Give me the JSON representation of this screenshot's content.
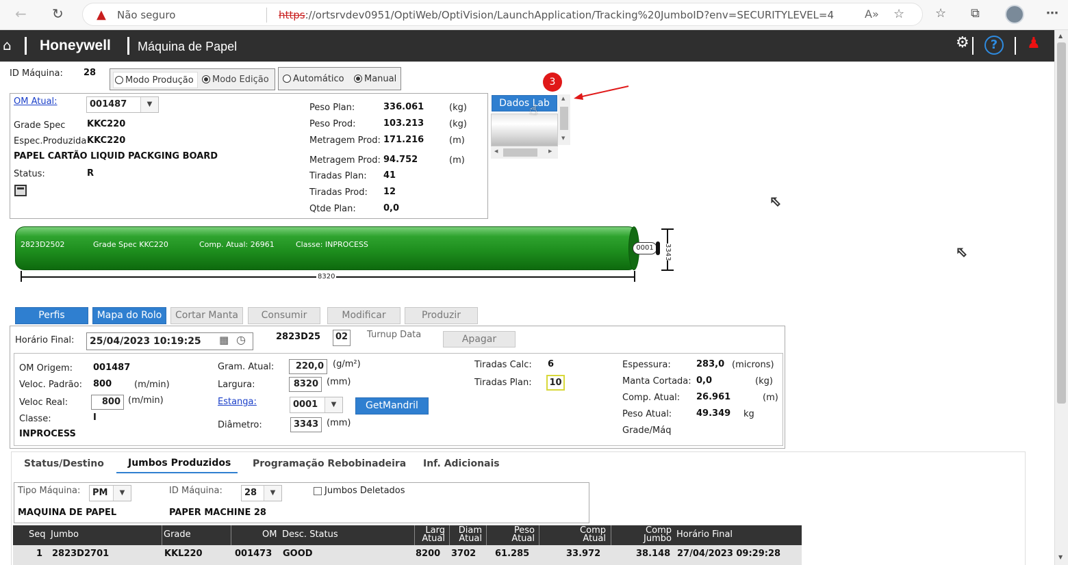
{
  "browser": {
    "security_text": "Não seguro",
    "url_scheme": "https",
    "url_rest": "://ortsrvdev0951/OptiWeb/OptiVision/LaunchApplication/Tracking%20JumboID?env=SECURITYLEVEL=4",
    "reader_icon": "A»"
  },
  "header": {
    "brand": "Honeywell",
    "title": "Máquina de Papel"
  },
  "top": {
    "id_label": "ID Máquina:",
    "id_value": "28",
    "mode_production": "Modo Produção",
    "mode_edit": "Modo Edição",
    "automatic": "Automático",
    "manual": "Manual"
  },
  "om_panel": {
    "om_label": "OM Atual:",
    "om_value": "001487",
    "grade_spec_label": "Grade Spec",
    "grade_spec_value": "KKC220",
    "espec_label": "Espec.Produzida",
    "espec_value": "KKC220",
    "product_name": "PAPEL CARTÃO LIQUID PACKGING BOARD",
    "status_label": "Status:",
    "status_value": "R",
    "stats": [
      {
        "label": "Peso Plan:",
        "value": "336.061",
        "unit": "(kg)"
      },
      {
        "label": "Peso Prod:",
        "value": "103.213",
        "unit": "(kg)"
      },
      {
        "label": "Metragem Prod:",
        "value": "171.216",
        "unit": "(m)"
      },
      {
        "label": "Metragem Prod:",
        "value": "94.752",
        "unit": "(m)"
      },
      {
        "label": "Tiradas Plan:",
        "value": "41",
        "unit": ""
      },
      {
        "label": "Tiradas Prod:",
        "value": "12",
        "unit": ""
      },
      {
        "label": "Qtde Plan:",
        "value": "0,0",
        "unit": ""
      }
    ]
  },
  "dados_lab": {
    "label": "Dados Lab",
    "badge": "3"
  },
  "roll": {
    "jumbo": "2823D2502",
    "grade": "Grade Spec KKC220",
    "comp": "Comp. Atual: 26961",
    "classe": "Classe: INPROCESS",
    "mandril": "0001",
    "width": "8320",
    "diameter": "3343"
  },
  "actions": {
    "perfis": "Perfis",
    "mapa": "Mapa do Rolo",
    "cortar": "Cortar Manta",
    "consumir": "Consumir",
    "modificar": "Modificar",
    "produzir": "Produzir"
  },
  "form": {
    "horario_label": "Horário Final:",
    "horario_value": "25/04/2023 10:19:25",
    "jumbo_prefix": "2823D25",
    "jumbo_suffix": "02",
    "turnup": "Turnup Data",
    "apagar": "Apagar",
    "om_origem_label": "OM Origem:",
    "om_origem_value": "001487",
    "veloc_padrao_label": "Veloc. Padrão:",
    "veloc_padrao_value": "800",
    "veloc_padrao_unit": "(m/min)",
    "veloc_real_label": "Veloc Real:",
    "veloc_real_value": "800",
    "veloc_real_unit": "(m/min)",
    "classe_label": "Classe:",
    "classe_value": "I",
    "classe_text": "INPROCESS",
    "gram_label": "Gram. Atual:",
    "gram_value": "220,0",
    "gram_unit": "(g/m²)",
    "largura_label": "Largura:",
    "largura_value": "8320",
    "largura_unit": "(mm)",
    "estanga_label": "Estanga:",
    "estanga_value": "0001",
    "getmandril": "GetMandril",
    "diametro_label": "Diâmetro:",
    "diametro_value": "3343",
    "diametro_unit": "(mm)",
    "tiradas_calc_label": "Tiradas Calc:",
    "tiradas_calc_value": "6",
    "tiradas_plan_label": "Tiradas Plan:",
    "tiradas_plan_value": "10",
    "espessura_label": "Espessura:",
    "espessura_value": "283,0",
    "espessura_unit": "(microns)",
    "manta_label": "Manta Cortada:",
    "manta_value": "0,0",
    "manta_unit": "(kg)",
    "comp_label": "Comp. Atual:",
    "comp_value": "26.961",
    "comp_unit": "(m)",
    "peso_label": "Peso Atual:",
    "peso_value": "49.349",
    "peso_unit": "kg",
    "grade_maq_label": "Grade/Máq"
  },
  "tabs": [
    "Status/Destino",
    "Jumbos Produzidos",
    "Programação Rebobinadeira",
    "Inf. Adicionais"
  ],
  "filters": {
    "tipo_label": "Tipo Máquina:",
    "tipo_value": "PM",
    "id_label": "ID Máquina:",
    "id_value": "28",
    "deleted_label": "Jumbos Deletados",
    "tipo_text": "MAQUINA DE PAPEL",
    "id_text": "PAPER MACHINE 28"
  },
  "table": {
    "headers": {
      "seq": "Seq",
      "jumbo": "Jumbo",
      "grade": "Grade",
      "om": "OM",
      "desc": "Desc. Status",
      "larg": [
        "Larg",
        "Atual"
      ],
      "diam": [
        "Diam",
        "Atual"
      ],
      "peso": [
        "Peso",
        "Atual"
      ],
      "comp": [
        "Comp",
        "Atual"
      ],
      "compj": [
        "Comp",
        "Jumbo"
      ],
      "horario": "Horário Final"
    },
    "rows": [
      {
        "seq": "1",
        "jumbo": "2823D2701",
        "grade": "KKL220",
        "om": "001473",
        "desc": "GOOD",
        "larg": "8200",
        "diam": "3702",
        "peso": "61.285",
        "comp": "33.972",
        "compj": "38.148",
        "horario": "27/04/2023 09:29:28"
      }
    ]
  }
}
